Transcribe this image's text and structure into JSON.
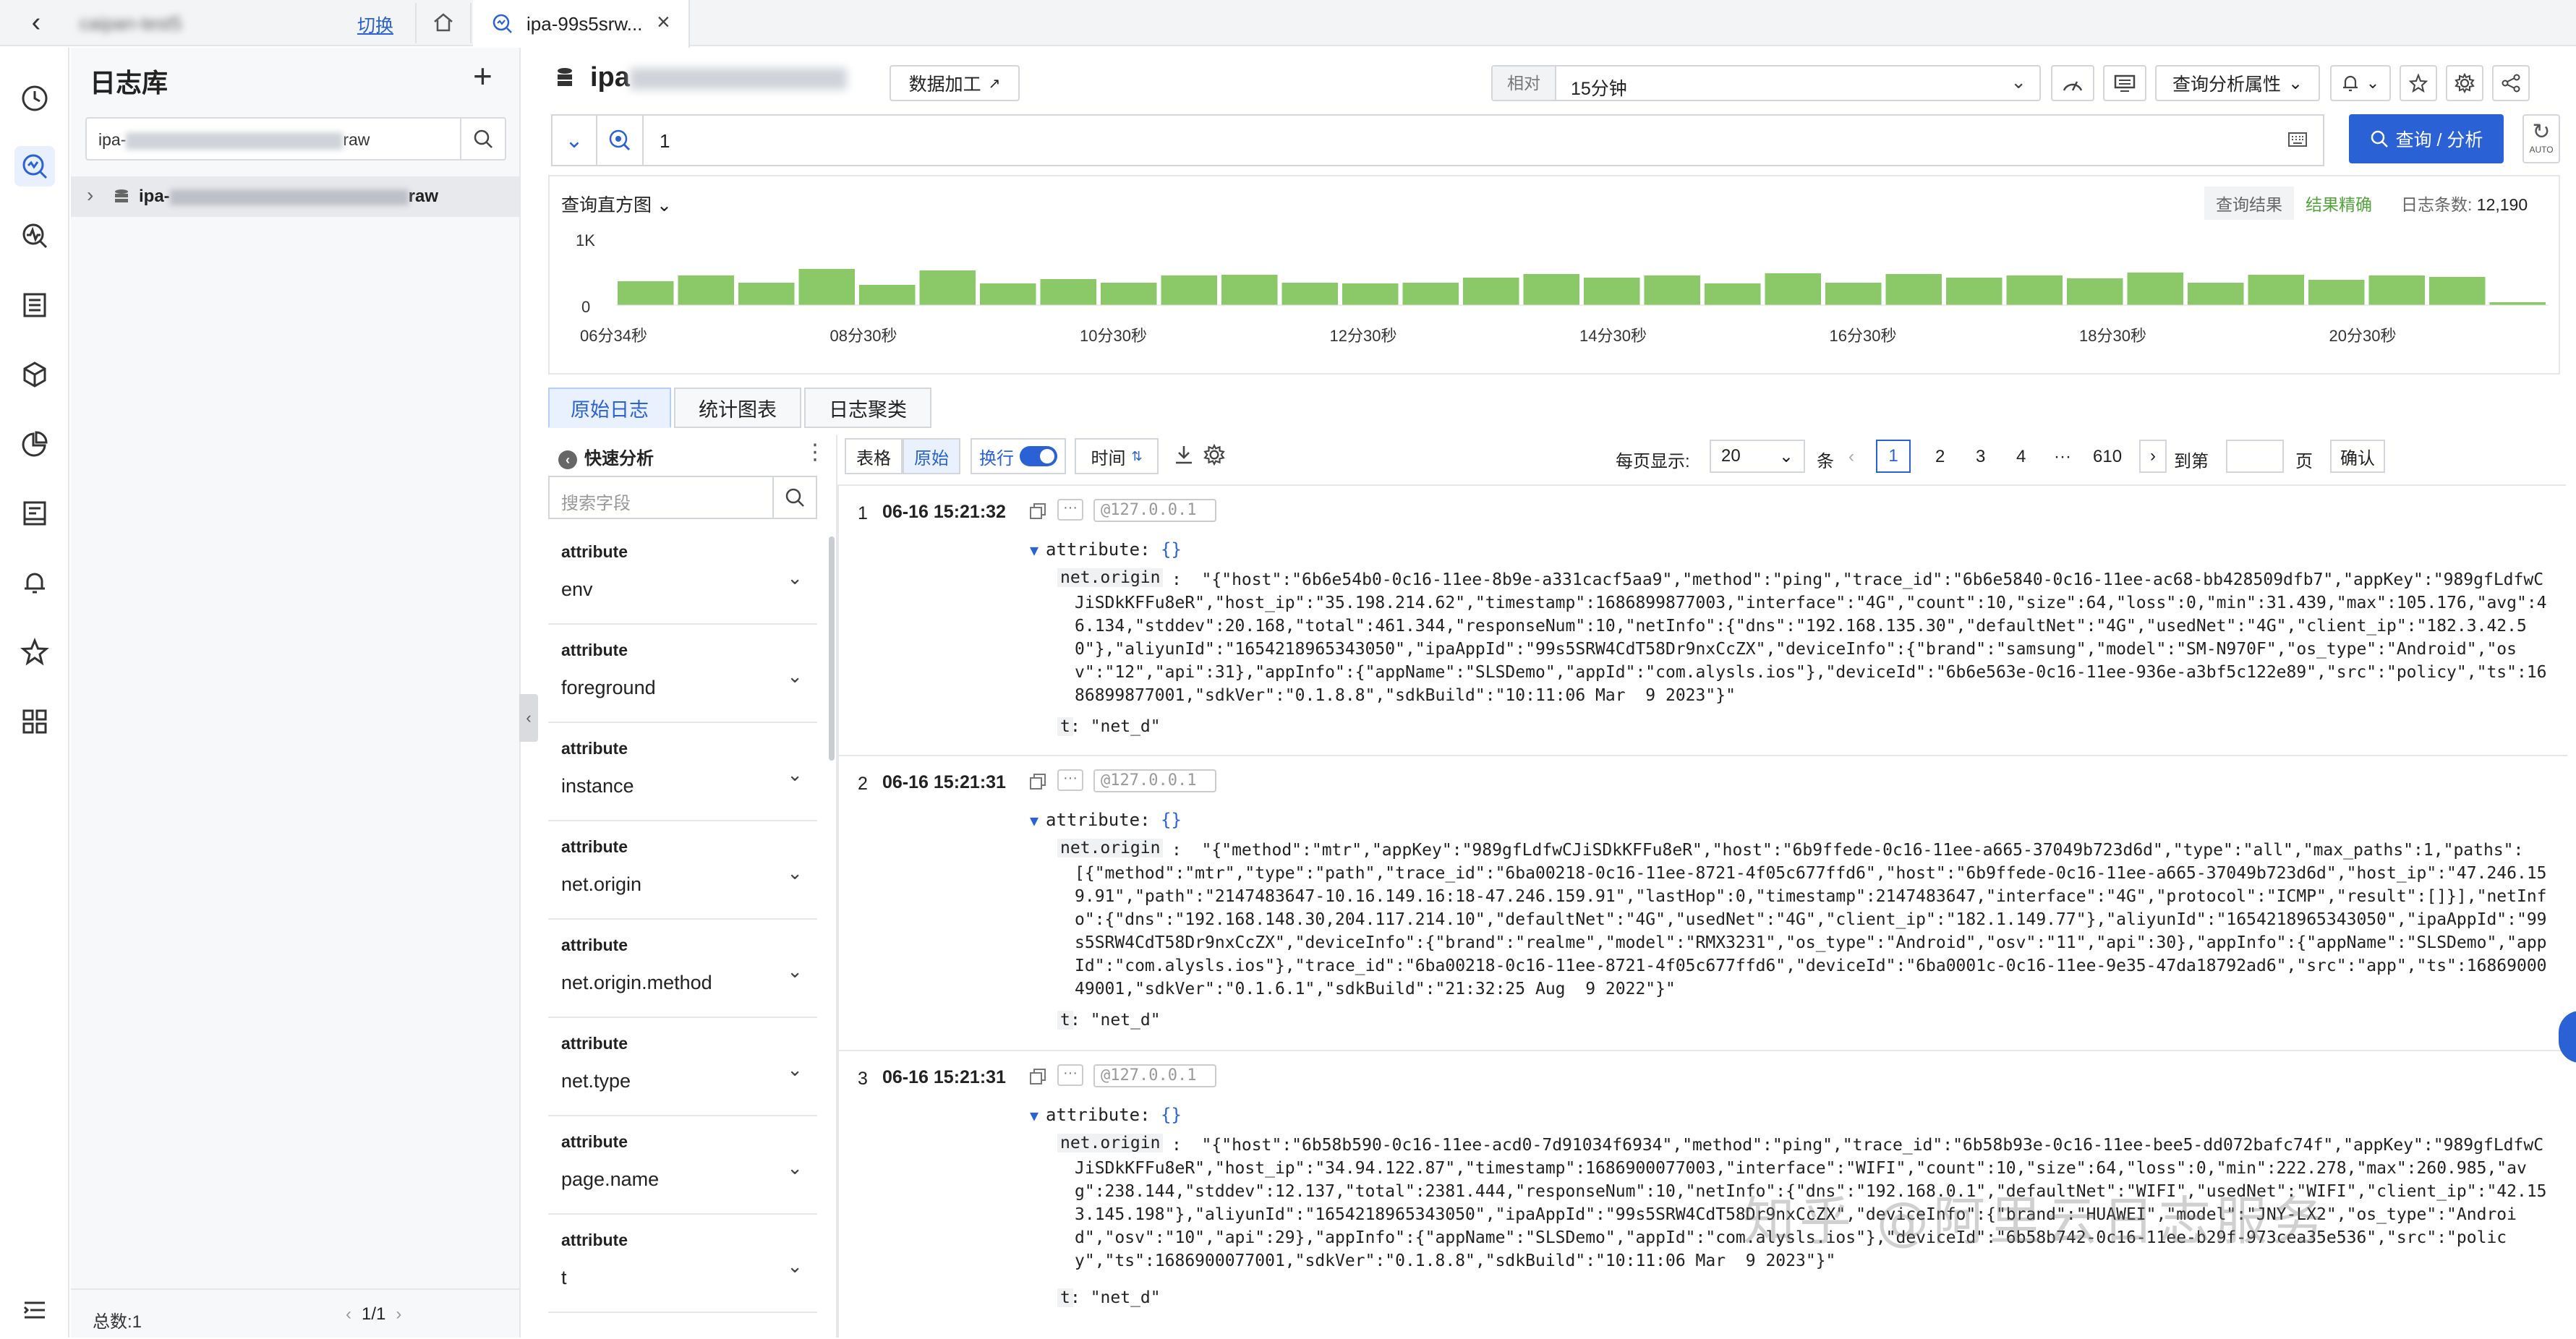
{
  "topbar": {
    "project_name": "caipan-test5",
    "switch_label": "切换",
    "tab_label": "ipa-99s5srw..."
  },
  "logstore_panel": {
    "title": "日志库",
    "search_prefix": "ipa-",
    "search_suffix": "raw",
    "item_prefix": "ipa-",
    "item_suffix": "raw",
    "total": "总数:1",
    "page": "1/1"
  },
  "header": {
    "title_prefix": "ipa",
    "data_process_label": "数据加工",
    "time_mode": "相对",
    "time_range": "15分钟",
    "analysis_props_label": "查询分析属性"
  },
  "query": {
    "text": "1",
    "search_button": "查询 / 分析",
    "auto_label": "AUTO"
  },
  "histogram": {
    "title": "查询直方图",
    "query_result": "查询结果",
    "accuracy": "结果精确",
    "log_count_label": "日志条数:",
    "log_count": "12,190",
    "y_max_label": "1K",
    "y_min_label": "0",
    "x_ticks": [
      "06分34秒",
      "08分30秒",
      "10分30秒",
      "12分30秒",
      "14分30秒",
      "16分30秒",
      "18分30秒",
      "20分30秒"
    ],
    "bar_color": "#8bc867"
  },
  "chart_data": {
    "type": "bar",
    "ylim": [
      0,
      1000
    ],
    "values": [
      330,
      410,
      310,
      500,
      280,
      480,
      300,
      360,
      310,
      410,
      420,
      310,
      300,
      310,
      380,
      430,
      380,
      410,
      300,
      440,
      310,
      430,
      380,
      410,
      370,
      450,
      310,
      420,
      350,
      410,
      390,
      40
    ]
  },
  "result_tabs": [
    "原始日志",
    "统计图表",
    "日志聚类"
  ],
  "quick_analysis": {
    "title": "快速分析",
    "search_placeholder": "搜索字段",
    "fields": [
      {
        "group": "attribute",
        "name": "env"
      },
      {
        "group": "attribute",
        "name": "foreground"
      },
      {
        "group": "attribute",
        "name": "instance"
      },
      {
        "group": "attribute",
        "name": "net.origin"
      },
      {
        "group": "attribute",
        "name": "net.origin.method"
      },
      {
        "group": "attribute",
        "name": "net.type"
      },
      {
        "group": "attribute",
        "name": "page.name"
      },
      {
        "group": "attribute",
        "name": "t"
      }
    ]
  },
  "toolbar": {
    "table": "表格",
    "raw": "原始",
    "wrap": "换行",
    "time": "时间",
    "per_page_label": "每页显示:",
    "per_page": "20",
    "unit": "条",
    "pages": [
      "1",
      "2",
      "3",
      "4",
      "···",
      "610"
    ],
    "goto": "到第",
    "page_unit": "页",
    "confirm": "确认"
  },
  "logs": [
    {
      "no": "1",
      "time": "06-16 15:21:32",
      "source": "@127.0.0.1",
      "attr": "attribute:",
      "brace": "{}",
      "key": "net.origin",
      "body": ":  \"{\"host\":\"6b6e54b0-0c16-11ee-8b9e-a331cacf5aa9\",\"method\":\"ping\",\"trace_id\":\"6b6e5840-0c16-11ee-ac68-bb428509dfb7\",\"appKey\":\"989gfLdfwCJiSDkKFFu8eR\",\"host_ip\":\"35.198.214.62\",\"timestamp\":1686899877003,\"interface\":\"4G\",\"count\":10,\"size\":64,\"loss\":0,\"min\":31.439,\"max\":105.176,\"avg\":46.134,\"stddev\":20.168,\"total\":461.344,\"responseNum\":10,\"netInfo\":{\"dns\":\"192.168.135.30\",\"defaultNet\":\"4G\",\"usedNet\":\"4G\",\"client_ip\":\"182.3.42.50\"},\"aliyunId\":\"1654218965343050\",\"ipaAppId\":\"99s5SRW4CdT58Dr9nxCcZX\",\"deviceInfo\":{\"brand\":\"samsung\",\"model\":\"SM-N970F\",\"os_type\":\"Android\",\"osv\":\"12\",\"api\":31},\"appInfo\":{\"appName\":\"SLSDemo\",\"appId\":\"com.alysls.ios\"},\"deviceId\":\"6b6e563e-0c16-11ee-936e-a3bf5c122e89\",\"src\":\"policy\",\"ts\":1686899877001,\"sdkVer\":\"0.1.8.8\",\"sdkBuild\":\"10:11:06 Mar  9 2023\"}\"",
      "t_key": "t",
      "t_val": ":  \"net_d\""
    },
    {
      "no": "2",
      "time": "06-16 15:21:31",
      "source": "@127.0.0.1",
      "attr": "attribute:",
      "brace": "{}",
      "key": "net.origin",
      "body": ":  \"{\"method\":\"mtr\",\"appKey\":\"989gfLdfwCJiSDkKFFu8eR\",\"host\":\"6b9ffede-0c16-11ee-a665-37049b723d6d\",\"type\":\"all\",\"max_paths\":1,\"paths\":[{\"method\":\"mtr\",\"type\":\"path\",\"trace_id\":\"6ba00218-0c16-11ee-8721-4f05c677ffd6\",\"host\":\"6b9ffede-0c16-11ee-a665-37049b723d6d\",\"host_ip\":\"47.246.159.91\",\"path\":\"2147483647-10.16.149.16:18-47.246.159.91\",\"lastHop\":0,\"timestamp\":2147483647,\"interface\":\"4G\",\"protocol\":\"ICMP\",\"result\":[]}],\"netInfo\":{\"dns\":\"192.168.148.30,204.117.214.10\",\"defaultNet\":\"4G\",\"usedNet\":\"4G\",\"client_ip\":\"182.1.149.77\"},\"aliyunId\":\"1654218965343050\",\"ipaAppId\":\"99s5SRW4CdT58Dr9nxCcZX\",\"deviceInfo\":{\"brand\":\"realme\",\"model\":\"RMX3231\",\"os_type\":\"Android\",\"osv\":\"11\",\"api\":30},\"appInfo\":{\"appName\":\"SLSDemo\",\"appId\":\"com.alysls.ios\"},\"trace_id\":\"6ba00218-0c16-11ee-8721-4f05c677ffd6\",\"deviceId\":\"6ba0001c-0c16-11ee-9e35-47da18792ad6\",\"src\":\"app\",\"ts\":1686900049001,\"sdkVer\":\"0.1.6.1\",\"sdkBuild\":\"21:32:25 Aug  9 2022\"}\"",
      "t_key": "t",
      "t_val": ":  \"net_d\""
    },
    {
      "no": "3",
      "time": "06-16 15:21:31",
      "source": "@127.0.0.1",
      "attr": "attribute:",
      "brace": "{}",
      "key": "net.origin",
      "body": ":  \"{\"host\":\"6b58b590-0c16-11ee-acd0-7d91034f6934\",\"method\":\"ping\",\"trace_id\":\"6b58b93e-0c16-11ee-bee5-dd072bafc74f\",\"appKey\":\"989gfLdfwCJiSDkKFFu8eR\",\"host_ip\":\"34.94.122.87\",\"timestamp\":1686900077003,\"interface\":\"WIFI\",\"count\":10,\"size\":64,\"loss\":0,\"min\":222.278,\"max\":260.985,\"avg\":238.144,\"stddev\":12.137,\"total\":2381.444,\"responseNum\":10,\"netInfo\":{\"dns\":\"192.168.0.1\",\"defaultNet\":\"WIFI\",\"usedNet\":\"WIFI\",\"client_ip\":\"42.153.145.198\"},\"aliyunId\":\"1654218965343050\",\"ipaAppId\":\"99s5SRW4CdT58Dr9nxCcZX\",\"deviceInfo\":{\"brand\":\"HUAWEI\",\"model\":\"JNY-LX2\",\"os_type\":\"Android\",\"osv\":\"10\",\"api\":29},\"appInfo\":{\"appName\":\"SLSDemo\",\"appId\":\"com.alysls.ios\"},\"deviceId\":\"6b58b742-0c16-11ee-b29f-973cea35e536\",\"src\":\"policy\",\"ts\":1686900077001,\"sdkVer\":\"0.1.8.8\",\"sdkBuild\":\"10:11:06 Mar  9 2023\"}\"",
      "t_key": "t",
      "t_val": ":  \"net_d\""
    }
  ],
  "watermark": "知乎 @阿里云日志服务"
}
